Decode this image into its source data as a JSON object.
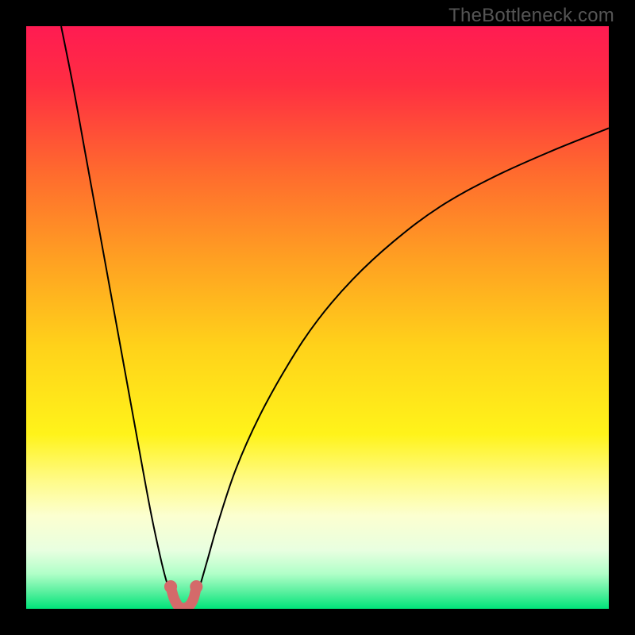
{
  "watermark": "TheBottleneck.com",
  "chart_data": {
    "type": "line",
    "title": "",
    "xlabel": "",
    "ylabel": "",
    "xlim": [
      0,
      100
    ],
    "ylim": [
      0,
      100
    ],
    "background_gradient": {
      "stops": [
        {
          "pos": 0.0,
          "color": "#ff1b52"
        },
        {
          "pos": 0.1,
          "color": "#ff2e42"
        },
        {
          "pos": 0.25,
          "color": "#ff6a2e"
        },
        {
          "pos": 0.4,
          "color": "#ffa022"
        },
        {
          "pos": 0.55,
          "color": "#ffd21a"
        },
        {
          "pos": 0.7,
          "color": "#fff31a"
        },
        {
          "pos": 0.78,
          "color": "#fffb88"
        },
        {
          "pos": 0.84,
          "color": "#fcffd0"
        },
        {
          "pos": 0.9,
          "color": "#e8ffe0"
        },
        {
          "pos": 0.94,
          "color": "#b0ffc8"
        },
        {
          "pos": 0.97,
          "color": "#5cf0a0"
        },
        {
          "pos": 1.0,
          "color": "#00e47a"
        }
      ]
    },
    "series": [
      {
        "name": "bottleneck-curve-left",
        "color": "#000000",
        "x": [
          6.0,
          8.0,
          10.0,
          12.0,
          14.0,
          16.0,
          18.0,
          20.0,
          21.5,
          23.0,
          24.0,
          25.0,
          25.7
        ],
        "y": [
          100.0,
          90.0,
          79.0,
          68.0,
          57.0,
          46.0,
          35.0,
          24.0,
          16.0,
          9.0,
          5.0,
          2.0,
          0.5
        ]
      },
      {
        "name": "bottleneck-curve-right",
        "color": "#000000",
        "x": [
          28.3,
          29.5,
          31.0,
          33.0,
          36.0,
          40.0,
          45.0,
          50.0,
          56.0,
          63.0,
          71.0,
          80.0,
          90.0,
          100.0
        ],
        "y": [
          0.5,
          3.0,
          8.0,
          15.0,
          24.0,
          33.0,
          42.0,
          49.5,
          56.5,
          63.0,
          69.0,
          74.0,
          78.5,
          82.5
        ]
      },
      {
        "name": "optimal-segment",
        "color": "#d46a6a",
        "x": [
          24.8,
          25.3,
          25.8,
          26.3,
          27.0,
          27.7,
          28.3,
          28.8,
          29.2
        ],
        "y": [
          3.8,
          2.0,
          0.9,
          0.3,
          0.1,
          0.3,
          0.9,
          2.0,
          3.8
        ]
      }
    ],
    "markers": [
      {
        "x": 24.8,
        "y": 3.8,
        "color": "#d46a6a",
        "r": 1.1
      },
      {
        "x": 29.2,
        "y": 3.8,
        "color": "#d46a6a",
        "r": 1.1
      }
    ]
  }
}
